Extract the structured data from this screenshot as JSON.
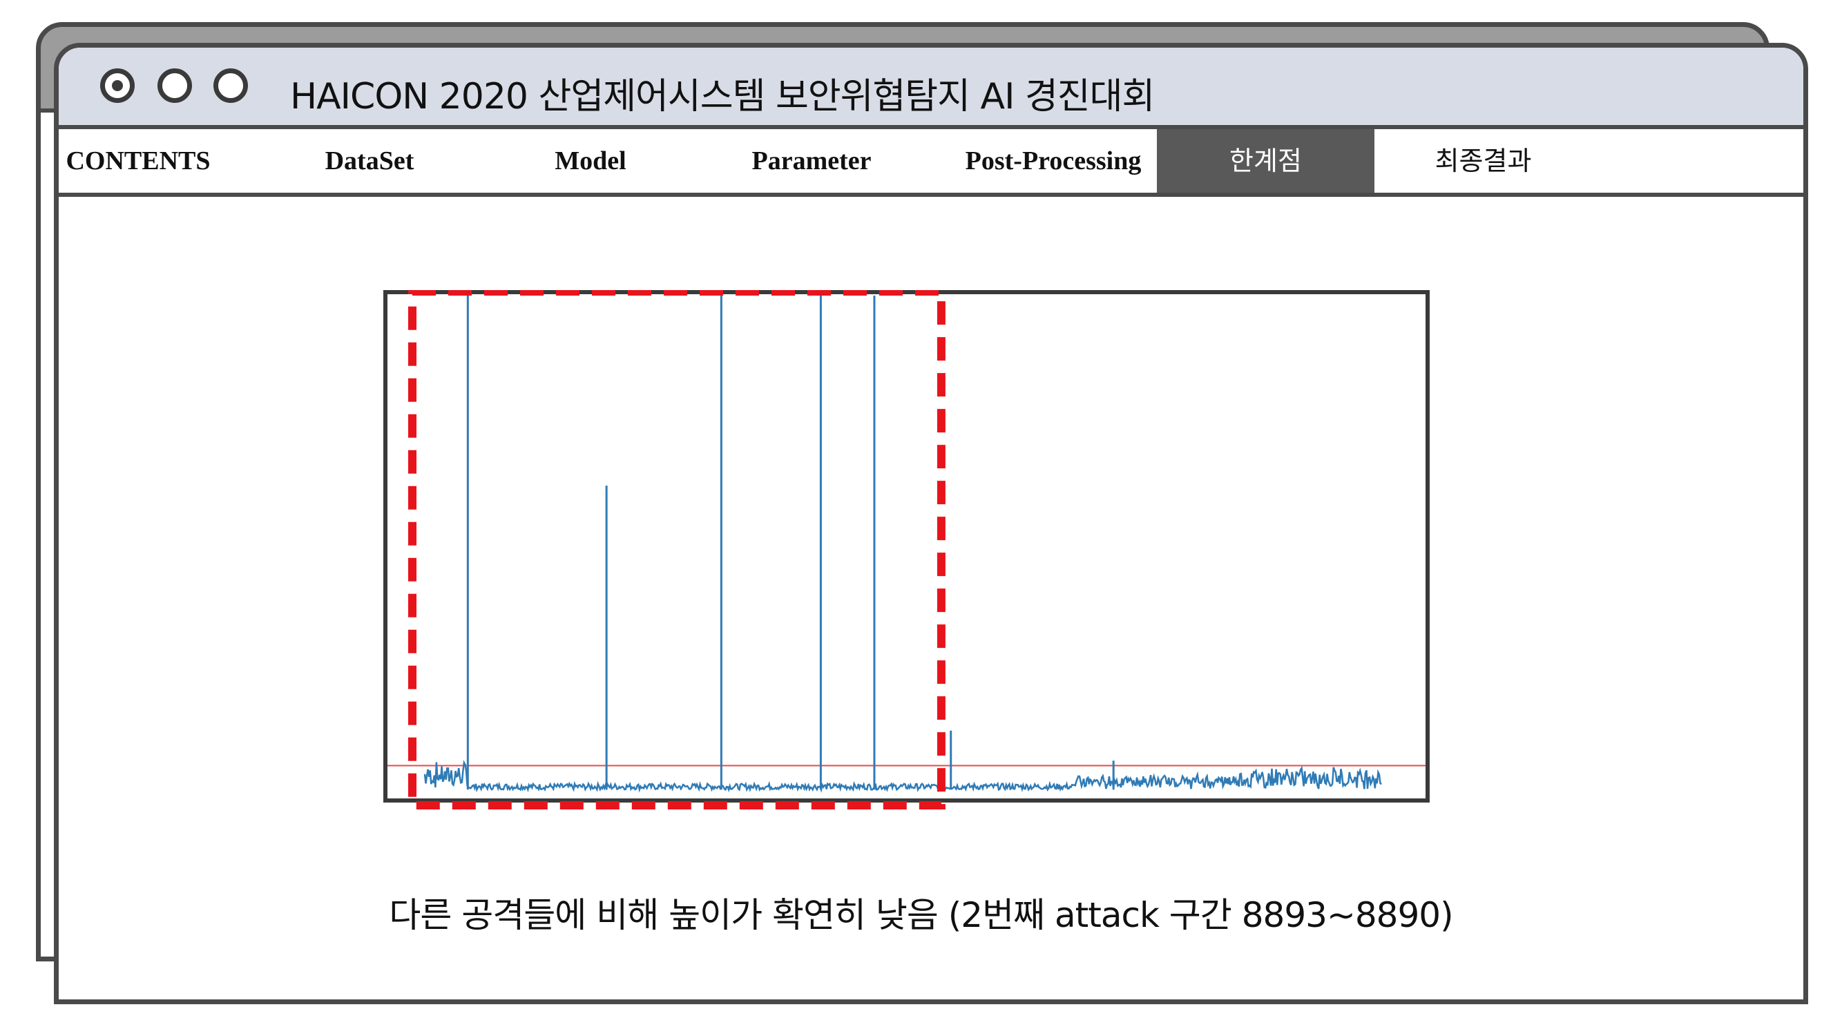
{
  "window": {
    "title": "HAICON 2020 산업제어시스템 보안위협탐지 AI 경진대회"
  },
  "nav": {
    "items": [
      {
        "label": "CONTENTS",
        "active": false
      },
      {
        "label": "DataSet",
        "active": false
      },
      {
        "label": "Model",
        "active": false
      },
      {
        "label": "Parameter",
        "active": false
      },
      {
        "label": "Post-Processing",
        "active": false
      },
      {
        "label": "한계점",
        "active": true
      },
      {
        "label": "최종결과",
        "active": false
      }
    ]
  },
  "caption": "다른 공격들에 비해 높이가 확연히 낮음 (2번째 attack 구간 8893~8890)",
  "colors": {
    "title_bar": "#d7dce6",
    "frame": "#4a4a4a",
    "nav_active": "#595959",
    "series": "#2f7bb6",
    "threshold": "#e84a4a",
    "highlight_box": "#e8141c"
  },
  "chart_data": {
    "type": "line",
    "title": "",
    "xlabel": "",
    "ylabel": "",
    "ylim": [
      0,
      1
    ],
    "grid": false,
    "threshold": 0.06,
    "baseline": 0.012,
    "spikes": [
      {
        "x": 0.045,
        "y": 1.0
      },
      {
        "x": 0.19,
        "y": 0.62
      },
      {
        "x": 0.31,
        "y": 1.0
      },
      {
        "x": 0.414,
        "y": 1.0
      },
      {
        "x": 0.47,
        "y": 1.0
      },
      {
        "x": 0.55,
        "y": 0.13
      },
      {
        "x": 0.72,
        "y": 0.07
      }
    ],
    "highlight_range": [
      0.0,
      0.54
    ]
  }
}
